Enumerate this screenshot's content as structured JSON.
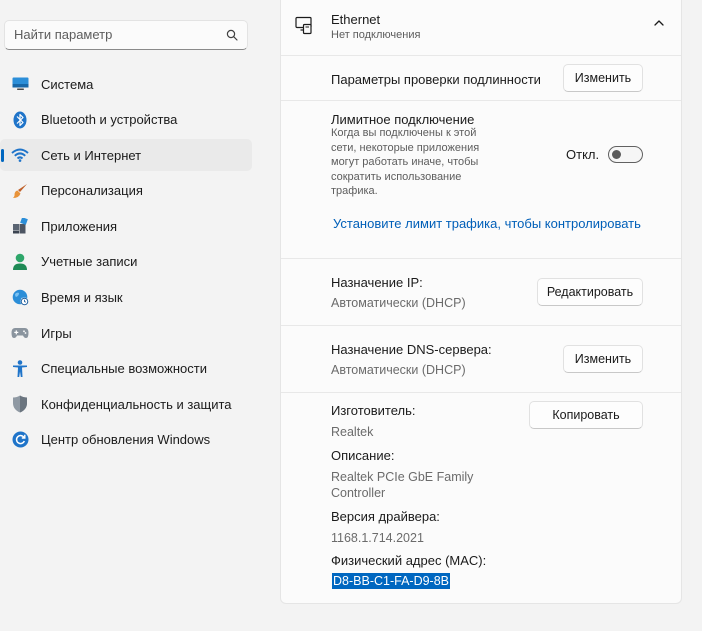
{
  "search": {
    "placeholder": "Найти параметр"
  },
  "sidebar": {
    "items": [
      {
        "label": "Система"
      },
      {
        "label": "Bluetooth и устройства"
      },
      {
        "label": "Сеть и Интернет"
      },
      {
        "label": "Персонализация"
      },
      {
        "label": "Приложения"
      },
      {
        "label": "Учетные записи"
      },
      {
        "label": "Время и язык"
      },
      {
        "label": "Игры"
      },
      {
        "label": "Специальные возможности"
      },
      {
        "label": "Конфиденциальность и защита"
      },
      {
        "label": "Центр обновления Windows"
      }
    ],
    "active_index": 2
  },
  "ethernet": {
    "title": "Ethernet",
    "status": "Нет подключения",
    "auth_label": "Параметры проверки подлинности",
    "auth_button": "Изменить",
    "metered_label": "Лимитное подключение",
    "metered_desc": [
      "Когда вы подключены к этой",
      "сети, некоторые приложения",
      "могут работать иначе, чтобы",
      "сократить использование",
      "трафика."
    ],
    "metered_state": "Откл.",
    "metered_on": false,
    "data_limit_link": "Установите лимит трафика, чтобы контролировать ис",
    "ip_label": "Назначение IP:",
    "ip_value": "Автоматически (DHCP)",
    "ip_button": "Редактировать",
    "dns_label": "Назначение DNS-сервера:",
    "dns_value": "Автоматически (DHCP)",
    "dns_button": "Изменить",
    "copy_button": "Копировать",
    "manufacturer_label": "Изготовитель:",
    "manufacturer_value": "Realtek",
    "description_label": "Описание:",
    "description_value": [
      "Realtek PCIe GbE Family",
      "Controller"
    ],
    "driver_label": "Версия драйвера:",
    "driver_value": "1168.1.714.2021",
    "mac_label": "Физический адрес (MAC):",
    "mac_value": "D8-BB-C1-FA-D9-8B"
  },
  "colors": {
    "accent": "#0067c0",
    "link": "#005fb8"
  }
}
